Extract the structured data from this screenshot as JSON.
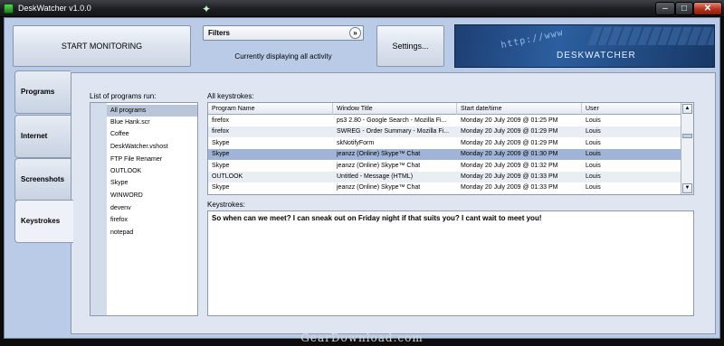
{
  "window": {
    "title": "DeskWatcher v1.0.0",
    "buttons": {
      "minimize": "–",
      "maximize": "□",
      "close": "✕"
    }
  },
  "toolbar": {
    "start_label": "START MONITORING",
    "settings_label": "Settings...",
    "filter_label": "Filters",
    "filter_status": "Currently displaying all activity"
  },
  "banner": {
    "brand": "DESKWATCHER",
    "url_text": "http://www"
  },
  "tabs": [
    "Programs",
    "Internet",
    "Screenshots",
    "Keystrokes"
  ],
  "active_tab": "Keystrokes",
  "programs": {
    "label": "List of programs run:",
    "items": [
      "All programs",
      "Blue Hank.scr",
      "Coffee",
      "DeskWatcher.vshost",
      "FTP File Renamer",
      "OUTLOOK",
      "Skype",
      "WINWORD",
      "devenv",
      "firefox",
      "notepad"
    ],
    "selected": "All programs"
  },
  "keystrokes_table": {
    "label": "All keystrokes:",
    "columns": [
      "Program Name",
      "Window Title",
      "Start date/time",
      "User"
    ],
    "rows": [
      [
        "firefox",
        "ps3 2.80 - Google Search - Mozilla Fi...",
        "Monday 20 July 2009 @ 01:25 PM",
        "Louis"
      ],
      [
        "firefox",
        "SWREG - Order Summary - Mozilla Fi...",
        "Monday 20 July 2009 @ 01:29 PM",
        "Louis"
      ],
      [
        "Skype",
        "skNotifyForm",
        "Monday 20 July 2009 @ 01:29 PM",
        "Louis"
      ],
      [
        "Skype",
        "jeanzz (Online) Skype™ Chat",
        "Monday 20 July 2009 @ 01:30 PM",
        "Louis"
      ],
      [
        "Skype",
        "jeanzz (Online) Skype™ Chat",
        "Monday 20 July 2009 @ 01:32 PM",
        "Louis"
      ],
      [
        "OUTLOOK",
        "Untitled - Message (HTML)",
        "Monday 20 July 2009 @ 01:33 PM",
        "Louis"
      ],
      [
        "Skype",
        "jeanzz (Online) Skype™ Chat",
        "Monday 20 July 2009 @ 01:33 PM",
        "Louis"
      ]
    ],
    "selected_row": 3,
    "scroll_up": "▲",
    "scroll_down": "▼"
  },
  "keystrokes": {
    "label": "Keystrokes:",
    "text": "So when can we meet? I can sneak out on Friday night if that suits you? I cant wait to meet you!"
  },
  "watermark": "GearDownload.com"
}
